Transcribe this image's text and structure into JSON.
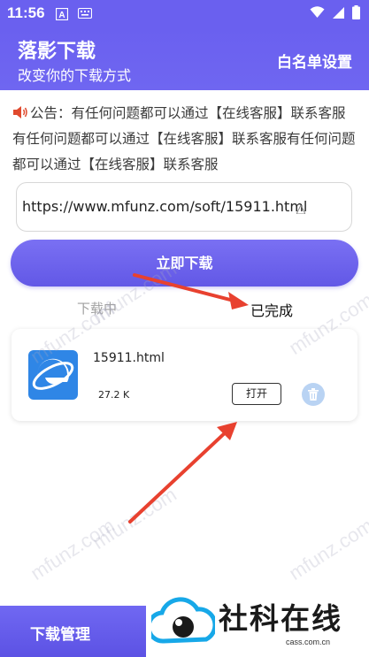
{
  "status_bar": {
    "time": "11:56",
    "icons": [
      "a-icon",
      "keyboard-icon",
      "wifi-icon",
      "signal-icon",
      "battery-icon"
    ]
  },
  "header": {
    "title": "落影下载",
    "subtitle": "改变你的下载方式",
    "whitelist_label": "白名单设置"
  },
  "notice": {
    "icon": "speaker-icon",
    "text": "公告：有任何问题都可以通过【在线客服】联系客服有任何问题都可以通过【在线客服】联系客服有任何问题都可以通过【在线客服】联系客服"
  },
  "url_input": {
    "value": "https://www.mfunz.com/soft/15911.html"
  },
  "download_button": {
    "label": "立即下载"
  },
  "tabs": [
    {
      "label": "下载中",
      "active": false
    },
    {
      "label": "已完成",
      "active": true
    }
  ],
  "files": [
    {
      "icon": "ie-browser-icon",
      "name": "15911.html",
      "size": "27.2 K",
      "open_label": "打开"
    }
  ],
  "bottom_nav": {
    "label": "下载管理"
  },
  "brand": {
    "name": "社科在线",
    "url": "cass.com.cn"
  },
  "watermark": "mfunz.com",
  "colors": {
    "primary": "#6a60ef",
    "arrow": "#e8412f",
    "trash": "#b9d3f3"
  }
}
